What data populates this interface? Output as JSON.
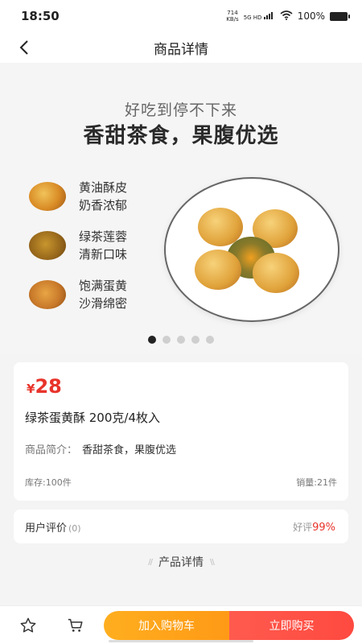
{
  "status_bar": {
    "time": "18:50",
    "net_speed_top": "714",
    "net_speed_bottom": "KB/s",
    "signal_label": "5G HD",
    "battery_text": "100%"
  },
  "header": {
    "title": "商品详情"
  },
  "banner": {
    "subtitle": "好吃到停不下来",
    "title": "香甜茶食，果腹优选",
    "features": [
      {
        "line1": "黄油酥皮",
        "line2": "奶香浓郁"
      },
      {
        "line1": "绿茶莲蓉",
        "line2": "清新口味"
      },
      {
        "line1": "饱满蛋黄",
        "line2": "沙滑绵密"
      }
    ],
    "slide_count": 5,
    "active_slide": 1
  },
  "product": {
    "currency": "¥",
    "price": "28",
    "name": "绿茶蛋黄酥 200克/4枚入",
    "intro_label": "商品简介：",
    "intro_value": "香甜茶食，果腹优选",
    "stock": "库存:100件",
    "sales": "销量:21件"
  },
  "reviews": {
    "label": "用户评价",
    "count": "(0)",
    "rate_label": "好评",
    "rate_value": "99%"
  },
  "detail_section": {
    "title": "产品详情"
  },
  "bottom_bar": {
    "favorite_icon": "star-outline-icon",
    "cart_icon": "shopping-cart-icon",
    "add_to_cart": "加入购物车",
    "buy_now": "立即购买"
  },
  "colors": {
    "price_red": "#e8342b",
    "cart_orange": "#ffa31b",
    "buy_red": "#ff5046"
  }
}
